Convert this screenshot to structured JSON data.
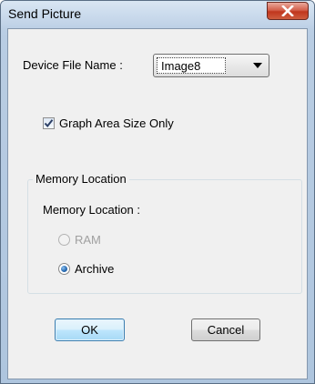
{
  "window": {
    "title": "Send Picture",
    "close_icon": "close-x-icon"
  },
  "device_file": {
    "label": "Device File Name :",
    "selected": "Image8"
  },
  "graph_area": {
    "label": "Graph Area Size Only",
    "checked": true
  },
  "memory_location": {
    "group_title": "Memory Location",
    "label": "Memory Location :",
    "options": [
      {
        "label": "RAM",
        "enabled": false,
        "selected": false
      },
      {
        "label": "Archive",
        "enabled": true,
        "selected": true
      }
    ]
  },
  "buttons": {
    "ok": "OK",
    "cancel": "Cancel"
  }
}
